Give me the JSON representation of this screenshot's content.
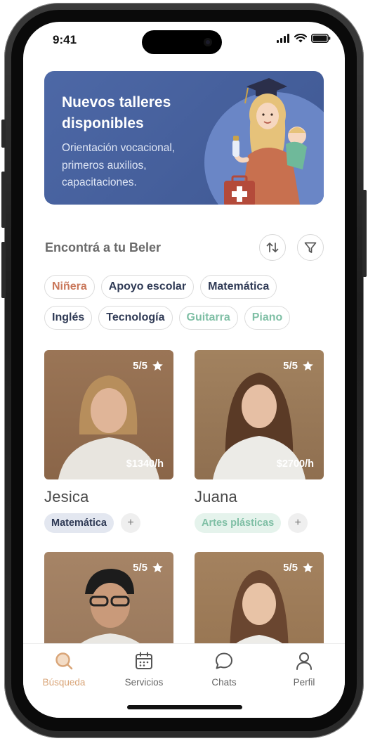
{
  "status_bar": {
    "time": "9:41"
  },
  "banner": {
    "title": "Nuevos talleres disponibles",
    "subtitle": "Orientación vocacional, primeros auxilios, capacitaciones."
  },
  "search": {
    "title": "Encontrá a tu Beler",
    "sort_icon": "sort-arrows-icon",
    "filter_icon": "filter-funnel-icon"
  },
  "chips": [
    {
      "label": "Niñera",
      "color": "#c9775a"
    },
    {
      "label": "Apoyo escolar",
      "color": "#2f3a55"
    },
    {
      "label": "Matemática",
      "color": "#2f3a55"
    },
    {
      "label": "Inglés",
      "color": "#2f3a55"
    },
    {
      "label": "Tecnología",
      "color": "#2f3a55"
    },
    {
      "label": "Guitarra",
      "color": "#7fbfa5"
    },
    {
      "label": "Piano",
      "color": "#7fbfa5"
    }
  ],
  "cards": [
    {
      "name": "Jesica",
      "rating": "5/5",
      "price": "$1340/h",
      "tag": "Matemática",
      "plus": "+"
    },
    {
      "name": "Juana",
      "rating": "5/5",
      "price": "$2700/h",
      "tag": "Artes plásticas",
      "plus": "+"
    },
    {
      "name": "",
      "rating": "5/5",
      "price": "",
      "tag": "",
      "plus": ""
    },
    {
      "name": "",
      "rating": "5/5",
      "price": "",
      "tag": "",
      "plus": ""
    }
  ],
  "tabs": [
    {
      "label": "Búsqueda",
      "icon": "search-icon",
      "active": true
    },
    {
      "label": "Servicios",
      "icon": "calendar-icon",
      "active": false
    },
    {
      "label": "Chats",
      "icon": "chat-bubble-icon",
      "active": false
    },
    {
      "label": "Perfil",
      "icon": "profile-icon",
      "active": false
    }
  ],
  "colors": {
    "accent": "#d9a578",
    "banner": "#4d68a6",
    "tag_math_bg": "#e3e7f0",
    "tag_arts_bg": "#e5f3ec"
  }
}
